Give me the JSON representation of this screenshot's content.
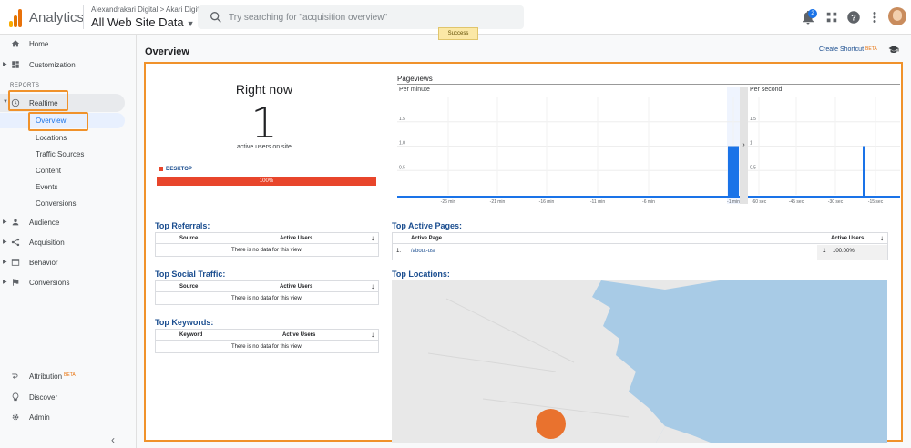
{
  "header": {
    "app_name": "Analytics",
    "account_path": "Alexandrakari Digital > Akari Digital",
    "view_name": "All Web Site Data",
    "search_placeholder": "Try searching for \"acquisition overview\"",
    "notification_count": "2",
    "toast": "Success",
    "logo_colors": [
      "#f9ab00",
      "#e37400",
      "#e8710a"
    ]
  },
  "sidebar": {
    "home": "Home",
    "customization": "Customization",
    "reports_header": "REPORTS",
    "realtime": "Realtime",
    "realtime_items": [
      "Overview",
      "Locations",
      "Traffic Sources",
      "Content",
      "Events",
      "Conversions"
    ],
    "audience": "Audience",
    "acquisition": "Acquisition",
    "behavior": "Behavior",
    "conversions": "Conversions",
    "attribution": "Attribution",
    "attribution_badge": "BETA",
    "discover": "Discover",
    "admin": "Admin",
    "collapse_icon": "chevron-left-icon"
  },
  "main": {
    "title": "Overview",
    "create_shortcut": "Create Shortcut",
    "create_shortcut_badge": "BETA",
    "right_now": {
      "title": "Right now",
      "count": "1",
      "subtitle": "active users on site",
      "device_label": "DESKTOP",
      "device_percent": "100%",
      "device_fraction": 1.0,
      "device_color": "#e8452b"
    },
    "pageviews": {
      "title": "Pageviews",
      "per_minute_label": "Per minute",
      "per_second_label": "Per second"
    },
    "top_referrals": {
      "title": "Top Referrals:",
      "col1": "Source",
      "col2": "Active Users",
      "empty": "There is no data for this view."
    },
    "top_social": {
      "title": "Top Social Traffic:",
      "col1": "Source",
      "col2": "Active Users",
      "empty": "There is no data for this view."
    },
    "top_keywords": {
      "title": "Top Keywords:",
      "col1": "Keyword",
      "col2": "Active Users",
      "empty": "There is no data for this view."
    },
    "top_active_pages": {
      "title": "Top Active Pages:",
      "col1": "Active Page",
      "col2": "Active Users",
      "rows": [
        {
          "index": "1.",
          "page": "/about-us/",
          "users": "1",
          "percent": "100.00%"
        }
      ]
    },
    "top_locations": {
      "title": "Top Locations:"
    }
  },
  "chart_data": [
    {
      "type": "bar",
      "title": "Per minute",
      "xlabel": "",
      "ylabel": "",
      "x_ticks": [
        "-26 min",
        "-21 min",
        "-16 min",
        "-11 min",
        "-6 min",
        "-1 min"
      ],
      "y_ticks": [
        "0.5",
        "1.0",
        "1.5"
      ],
      "ylim": [
        0,
        2
      ],
      "categories": [
        "-1 min"
      ],
      "values": [
        1
      ],
      "color": "#1a73e8"
    },
    {
      "type": "bar",
      "title": "Per second",
      "xlabel": "",
      "ylabel": "",
      "x_ticks": [
        "-60 sec",
        "-45 sec",
        "-30 sec",
        "-15 sec"
      ],
      "y_ticks": [
        "0.5",
        "1",
        "1.5"
      ],
      "ylim": [
        0,
        2
      ],
      "categories": [
        "-17 sec"
      ],
      "values": [
        1
      ],
      "color": "#1a73e8"
    }
  ]
}
